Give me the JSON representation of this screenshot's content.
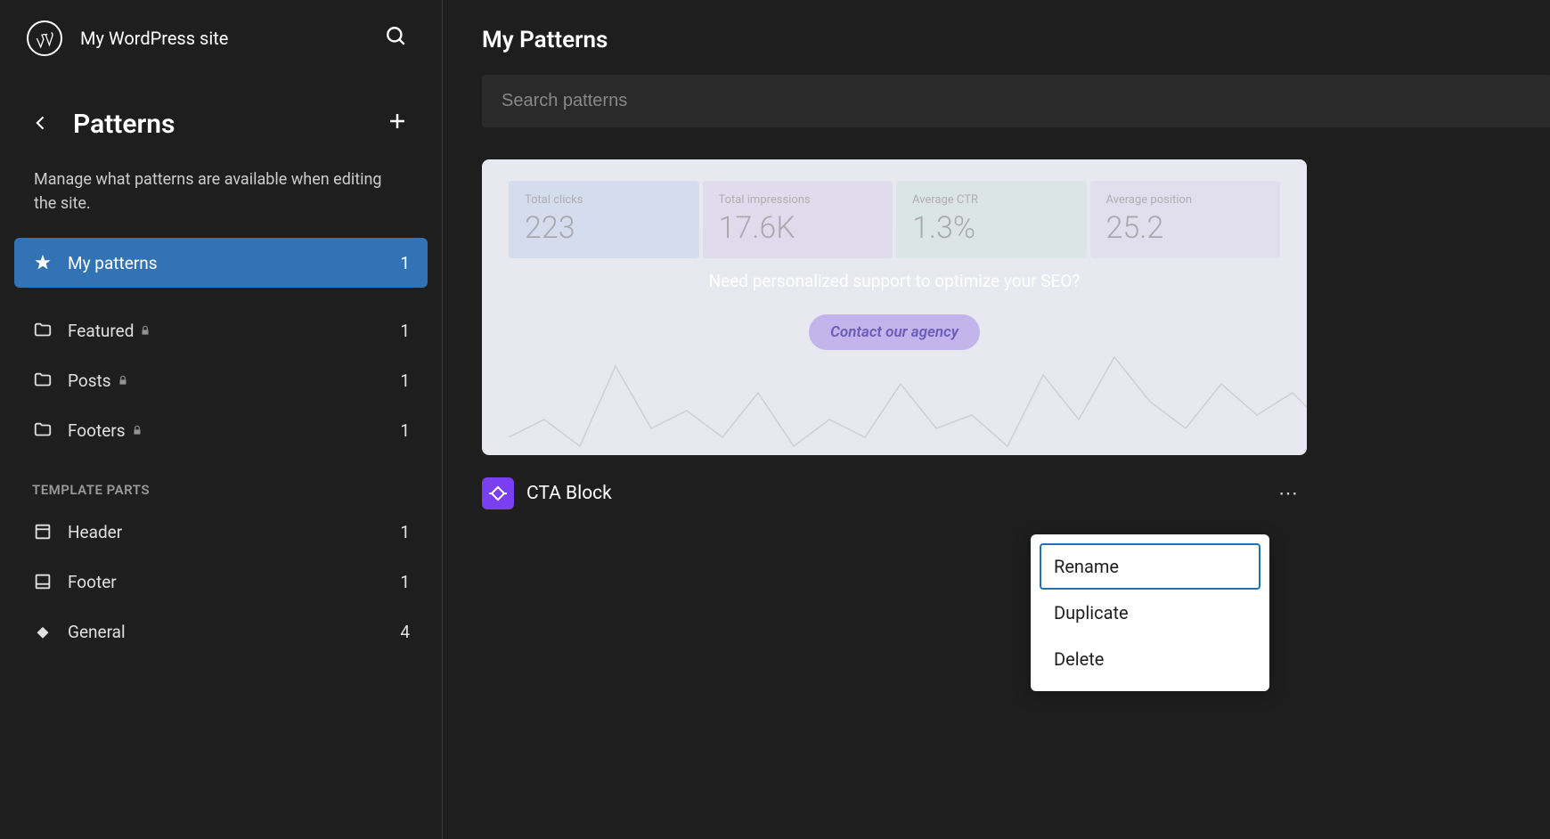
{
  "site_title": "My WordPress site",
  "nav": {
    "title": "Patterns",
    "description": "Manage what patterns are available when editing the site."
  },
  "categories": [
    {
      "label": "My patterns",
      "count": "1",
      "icon": "star",
      "active": true,
      "locked": false
    },
    {
      "label": "Featured",
      "count": "1",
      "icon": "folder",
      "active": false,
      "locked": true
    },
    {
      "label": "Posts",
      "count": "1",
      "icon": "folder",
      "active": false,
      "locked": true
    },
    {
      "label": "Footers",
      "count": "1",
      "icon": "folder",
      "active": false,
      "locked": true
    }
  ],
  "template_parts_title": "TEMPLATE PARTS",
  "template_parts": [
    {
      "label": "Header",
      "count": "1",
      "icon": "header"
    },
    {
      "label": "Footer",
      "count": "1",
      "icon": "footer"
    },
    {
      "label": "General",
      "count": "4",
      "icon": "diamond"
    }
  ],
  "main": {
    "title": "My Patterns",
    "search_placeholder": "Search patterns"
  },
  "pattern": {
    "name": "CTA Block",
    "preview": {
      "stats": [
        {
          "label": "Total clicks",
          "value": "223"
        },
        {
          "label": "Total impressions",
          "value": "17.6K"
        },
        {
          "label": "Average CTR",
          "value": "1.3%"
        },
        {
          "label": "Average position",
          "value": "25.2"
        }
      ],
      "cta_text": "Need personalized support to optimize your SEO?",
      "cta_button": "Contact our agency"
    }
  },
  "context_menu": [
    {
      "label": "Rename",
      "focused": true
    },
    {
      "label": "Duplicate",
      "focused": false
    },
    {
      "label": "Delete",
      "focused": false
    }
  ]
}
